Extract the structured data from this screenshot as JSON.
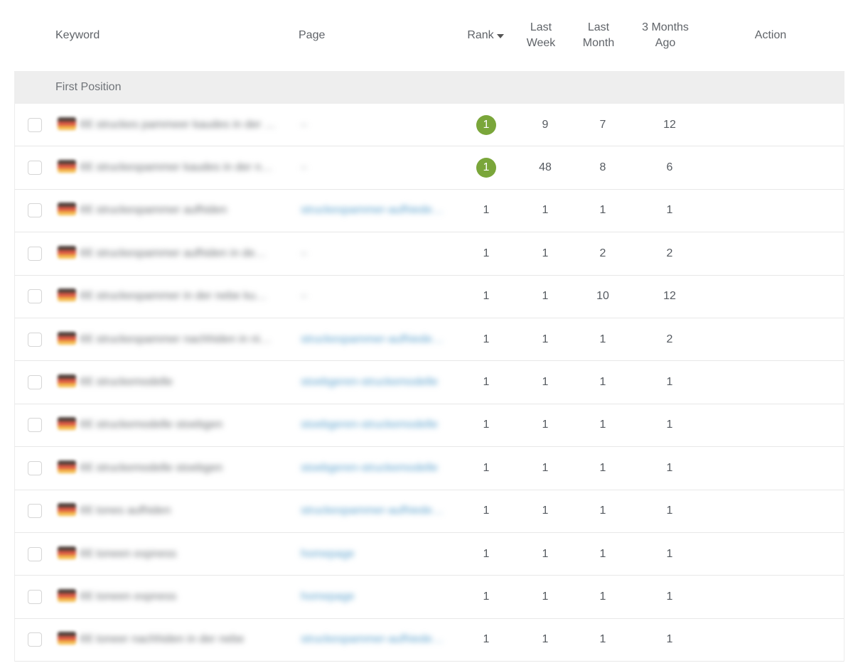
{
  "columns": {
    "keyword": "Keyword",
    "page": "Page",
    "rank": "Rank",
    "last_week_line1": "Last",
    "last_week_line2": "Week",
    "last_month_line1": "Last",
    "last_month_line2": "Month",
    "three_months_line1": "3 Months",
    "three_months_line2": "Ago",
    "action": "Action"
  },
  "group": {
    "label": "First Position"
  },
  "rows": [
    {
      "keyword": "€€ struckes pammeer kaudes in der …",
      "page": "–",
      "rank": "1",
      "rank_badge": true,
      "last_week": "9",
      "last_month": "7",
      "three_months": "12"
    },
    {
      "keyword": "€€ struckespammer kaudes in der n…",
      "page": "–",
      "rank": "1",
      "rank_badge": true,
      "last_week": "48",
      "last_month": "8",
      "three_months": "6"
    },
    {
      "keyword": "€€ struckespammer aufhiden",
      "page": "struckespammer-aufhiede…",
      "rank": "1",
      "rank_badge": false,
      "last_week": "1",
      "last_month": "1",
      "three_months": "1"
    },
    {
      "keyword": "€€ struckespammer aufhiden in de…",
      "page": "–",
      "rank": "1",
      "rank_badge": false,
      "last_week": "1",
      "last_month": "2",
      "three_months": "2"
    },
    {
      "keyword": "€€ struckespammer in der nebe ku…",
      "page": "–",
      "rank": "1",
      "rank_badge": false,
      "last_week": "1",
      "last_month": "10",
      "three_months": "12"
    },
    {
      "keyword": "€€ struckespammer nachhiden in ni…",
      "page": "struckespammer-aufhiede…",
      "rank": "1",
      "rank_badge": false,
      "last_week": "1",
      "last_month": "1",
      "three_months": "2"
    },
    {
      "keyword": "€€ struckemodelle",
      "page": "stoebgeren-struckemodelle",
      "rank": "1",
      "rank_badge": false,
      "last_week": "1",
      "last_month": "1",
      "three_months": "1"
    },
    {
      "keyword": "€€ struckemodelle stoebgen",
      "page": "stoebgeren-struckemodelle",
      "rank": "1",
      "rank_badge": false,
      "last_week": "1",
      "last_month": "1",
      "three_months": "1"
    },
    {
      "keyword": "€€ struckemodelle stoebgen",
      "page": "stoebgeren-struckemodelle",
      "rank": "1",
      "rank_badge": false,
      "last_week": "1",
      "last_month": "1",
      "three_months": "1"
    },
    {
      "keyword": "€€ tones aufhiden",
      "page": "struckespammer-aufhiede…",
      "rank": "1",
      "rank_badge": false,
      "last_week": "1",
      "last_month": "1",
      "three_months": "1"
    },
    {
      "keyword": "€€ toneen expness",
      "page": "homepage",
      "rank": "1",
      "rank_badge": false,
      "last_week": "1",
      "last_month": "1",
      "three_months": "1"
    },
    {
      "keyword": "€€ toneen expness",
      "page": "homepage",
      "rank": "1",
      "rank_badge": false,
      "last_week": "1",
      "last_month": "1",
      "three_months": "1"
    },
    {
      "keyword": "€€ toneer nachhiden in der nebe",
      "page": "struckespammer-aufhiede…",
      "rank": "1",
      "rank_badge": false,
      "last_week": "1",
      "last_month": "1",
      "three_months": "1"
    }
  ],
  "colors": {
    "badge": "#7aa63a",
    "group_bg": "#eeeeee",
    "link": "#5aa0cc"
  }
}
